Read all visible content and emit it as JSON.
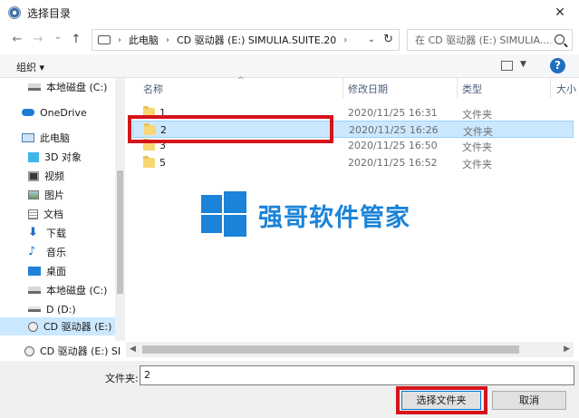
{
  "window": {
    "title": "选择目录",
    "close_glyph": "✕"
  },
  "nav": {
    "back_glyph": "←",
    "forward_glyph": "→",
    "dropdown_glyph": "⌄",
    "up_glyph": "↑",
    "breadcrumb": [
      "此电脑",
      "CD 驱动器 (E:) SIMULIA.SUITE.20"
    ],
    "breadcrumb_sep": "›",
    "refresh_glyph": "↻",
    "search_placeholder": "在 CD 驱动器 (E:) SIMULIA...."
  },
  "toolbar": {
    "organize_label": "组织 ▾",
    "view_dd_glyph": "▼",
    "help_label": "?"
  },
  "sidebar": {
    "items": [
      {
        "label": "本地磁盘 (C:)",
        "icon": "drive-icon"
      },
      {
        "label": "OneDrive",
        "icon": "cloud-icon"
      },
      {
        "label": "此电脑",
        "icon": "computer-icon"
      },
      {
        "label": "3D 对象",
        "icon": "cube-icon"
      },
      {
        "label": "视频",
        "icon": "video-icon"
      },
      {
        "label": "图片",
        "icon": "picture-icon"
      },
      {
        "label": "文档",
        "icon": "document-icon"
      },
      {
        "label": "下载",
        "icon": "download-icon"
      },
      {
        "label": "音乐",
        "icon": "music-icon"
      },
      {
        "label": "桌面",
        "icon": "desktop-icon"
      },
      {
        "label": "本地磁盘 (C:)",
        "icon": "drive-icon"
      },
      {
        "label": "D (D:)",
        "icon": "drive-icon"
      },
      {
        "label": "CD 驱动器 (E:) S",
        "icon": "cd-drive-icon"
      }
    ],
    "bottom_item": "CD 驱动器 (E:) SI"
  },
  "columns": {
    "name": "名称",
    "sort_glyph": "^",
    "date": "修改日期",
    "type": "类型",
    "size": "大小"
  },
  "files": [
    {
      "name": "1",
      "date": "2020/11/25 16:31",
      "type": "文件夹"
    },
    {
      "name": "2",
      "date": "2020/11/25 16:26",
      "type": "文件夹",
      "selected": true
    },
    {
      "name": "3",
      "date": "2020/11/25 16:50",
      "type": "文件夹"
    },
    {
      "name": "5",
      "date": "2020/11/25 16:52",
      "type": "文件夹"
    }
  ],
  "watermark": {
    "text": "强哥软件管家"
  },
  "scroll": {
    "left_glyph": "◀",
    "right_glyph": "▶"
  },
  "footer": {
    "folder_label": "文件夹:",
    "folder_value": "2",
    "select_button": "选择文件夹",
    "cancel_button": "取消"
  },
  "colors": {
    "accent": "#0078d7",
    "selection": "#cce8ff",
    "highlight": "#d4141b",
    "watermark": "#1b83d8"
  }
}
